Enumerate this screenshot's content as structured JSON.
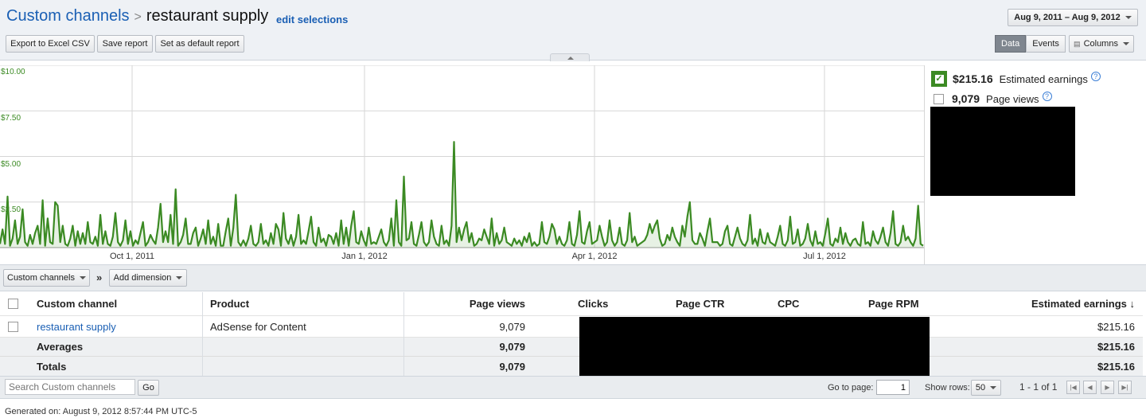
{
  "header": {
    "breadcrumb_root": "Custom channels",
    "breadcrumb_sep": ">",
    "breadcrumb_current": "restaurant supply",
    "edit_selections": "edit selections",
    "date_range": "Aug 9, 2011 – Aug 9, 2012",
    "buttons": {
      "export": "Export to Excel CSV",
      "save": "Save report",
      "default": "Set as default report"
    },
    "view_toggle": {
      "data": "Data",
      "events": "Events",
      "columns": "Columns"
    }
  },
  "chart_data": {
    "type": "area",
    "title": "",
    "series": [
      {
        "name": "Estimated earnings",
        "color": "#3b8a23",
        "values": [
          0.2,
          1.0,
          0.2,
          2.8,
          0.1,
          0.5,
          1.5,
          0.2,
          0.6,
          2.1,
          0.3,
          0.1,
          0.7,
          0.2,
          0.8,
          1.2,
          0.2,
          2.6,
          0.1,
          1.6,
          0.3,
          0.2,
          2.5,
          2.3,
          0.3,
          1.2,
          0.2,
          0.1,
          0.5,
          1.2,
          0.1,
          0.9,
          0.2,
          0.8,
          0.2,
          1.4,
          0.3,
          0.2,
          0.6,
          0.1,
          1.8,
          0.2,
          0.9,
          0.2,
          0.1,
          0.6,
          1.9,
          0.3,
          0.1,
          0.4,
          1.5,
          0.2,
          0.9,
          0.1,
          0.4,
          0.2,
          0.8,
          1.4,
          0.1,
          0.3,
          0.7,
          0.4,
          0.2,
          1.1,
          2.4,
          0.3,
          0.9,
          0.3,
          1.8,
          0.2,
          3.2,
          0.1,
          0.3,
          0.7,
          1.6,
          0.2,
          0.2,
          0.8,
          1.1,
          0.1,
          0.5,
          1.0,
          0.2,
          1.5,
          0.2,
          0.6,
          0.1,
          1.3,
          0.1,
          0.1,
          0.9,
          1.6,
          0.1,
          1.1,
          2.9,
          0.3,
          0.1,
          0.4,
          0.1,
          0.5,
          1.2,
          0.2,
          0.1,
          0.3,
          1.3,
          0.2,
          0.4,
          0.1,
          0.8,
          0.2,
          1.3,
          1.0,
          0.1,
          1.9,
          0.5,
          0.2,
          0.7,
          0.1,
          0.6,
          1.8,
          0.2,
          0.4,
          0.2,
          0.9,
          1.7,
          0.3,
          0.1,
          1.1,
          0.3,
          0.5,
          0.1,
          0.7,
          0.6,
          0.2,
          0.8,
          0.1,
          1.5,
          0.2,
          1.1,
          0.1,
          1.2,
          2.0,
          0.3,
          0.2,
          0.9,
          0.4,
          0.1,
          1.1,
          0.2,
          0.3,
          0.2,
          0.6,
          1.0,
          0.3,
          0.1,
          0.4,
          1.6,
          0.1,
          2.6,
          0.3,
          0.1,
          3.9,
          0.4,
          0.5,
          1.4,
          0.2,
          0.1,
          0.7,
          1.4,
          0.3,
          0.1,
          0.3,
          1.5,
          0.6,
          0.2,
          0.1,
          1.2,
          0.2,
          0.4,
          0.1,
          1.2,
          5.8,
          0.3,
          1.1,
          0.4,
          1.0,
          1.4,
          0.3,
          0.8,
          0.1,
          0.2,
          0.5,
          0.4,
          1.0,
          0.6,
          0.2,
          1.6,
          0.1,
          0.8,
          0.2,
          0.4,
          1.1,
          0.3,
          0.2,
          0.1,
          0.5,
          0.2,
          0.4,
          0.1,
          0.6,
          0.3,
          0.8,
          0.1,
          0.3,
          0.1,
          0.2,
          1.4,
          0.3,
          0.2,
          0.6,
          1.3,
          1.0,
          0.2,
          0.6,
          0.2,
          0.1,
          0.4,
          1.4,
          0.2,
          0.1,
          0.7,
          2.0,
          0.3,
          0.2,
          0.9,
          1.4,
          0.2,
          0.3,
          0.4,
          1.2,
          0.6,
          0.1,
          0.3,
          1.5,
          0.4,
          0.1,
          0.3,
          1.1,
          0.2,
          0.1,
          0.4,
          1.9,
          0.3,
          0.6,
          0.1,
          0.2,
          0.3,
          0.4,
          0.7,
          1.3,
          0.8,
          1.2,
          1.5,
          0.5,
          0.1,
          0.2,
          0.7,
          0.4,
          1.1,
          0.6,
          0.3,
          0.1,
          1.2,
          0.6,
          1.7,
          2.5,
          0.4,
          0.2,
          0.2,
          0.8,
          0.5,
          0.1,
          0.9,
          1.6,
          0.3,
          0.3,
          0.3,
          0.1,
          0.2,
          0.9,
          1.2,
          0.2,
          0.1,
          0.6,
          1.1,
          0.5,
          0.2,
          0.1,
          0.4,
          1.8,
          0.2,
          0.5,
          0.1,
          1.0,
          0.3,
          0.2,
          0.8,
          0.3,
          0.2,
          0.1,
          0.6,
          1.2,
          0.2,
          0.1,
          0.4,
          1.7,
          0.2,
          0.3,
          1.0,
          0.1,
          0.2,
          0.5,
          1.3,
          0.4,
          0.1,
          0.9,
          0.2,
          0.3,
          0.1,
          0.8,
          1.6,
          0.2,
          0.1,
          0.5,
          0.3,
          1.1,
          0.2,
          0.8,
          0.3,
          0.1,
          0.4,
          0.5,
          0.2,
          0.1,
          1.4,
          0.2,
          0.3,
          0.1,
          0.9,
          0.4,
          0.2,
          0.6,
          1.1,
          0.3,
          0.1,
          0.8,
          2.0,
          0.2,
          0.1,
          0.3,
          1.2,
          0.4,
          0.6,
          0.3,
          0.1,
          0.5,
          2.3,
          0.2,
          0.1
        ]
      }
    ],
    "ylim": [
      0,
      10
    ],
    "y_ticks": [
      "$10.00",
      "$7.50",
      "$5.00",
      "$2.50"
    ],
    "x_ticks": [
      "Oct 1, 2011",
      "Jan 1, 2012",
      "Apr 1, 2012",
      "Jul 1, 2012"
    ],
    "grid": true
  },
  "metrics": [
    {
      "value": "$215.16",
      "name": "Estimated earnings",
      "checked": true
    },
    {
      "value": "9,079",
      "name": "Page views",
      "checked": false
    }
  ],
  "dimensions": {
    "dim1": "Custom channels",
    "arrow": "»",
    "dim2": "Add dimension"
  },
  "table": {
    "headers": [
      "Custom channel",
      "Product",
      "Page views",
      "Clicks",
      "Page CTR",
      "CPC",
      "Page RPM",
      "Estimated earnings ↓"
    ],
    "rows": [
      {
        "channel": "restaurant supply",
        "product": "AdSense for Content",
        "page_views": "9,079",
        "earnings": "$215.16"
      }
    ],
    "averages": {
      "label": "Averages",
      "page_views": "9,079",
      "earnings": "$215.16"
    },
    "totals": {
      "label": "Totals",
      "page_views": "9,079",
      "earnings": "$215.16"
    }
  },
  "footer": {
    "search_placeholder": "Search Custom channels",
    "go": "Go",
    "go_to_page": "Go to page:",
    "page": "1",
    "show_rows": "Show rows:",
    "rows_value": "50",
    "range": "1 - 1 of 1",
    "generated": "Generated on: August 9, 2012 8:57:44 PM UTC-5"
  }
}
